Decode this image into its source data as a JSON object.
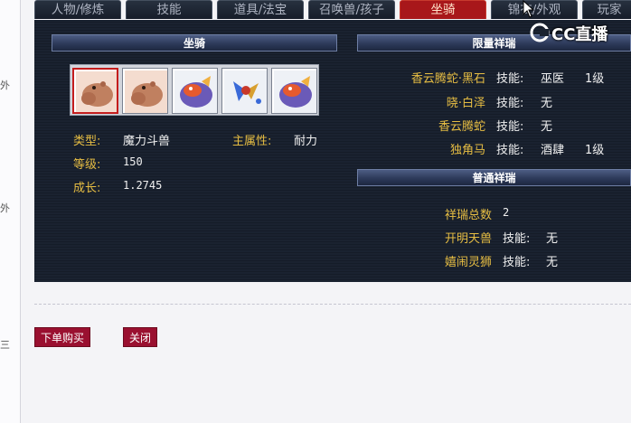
{
  "left_marks": [
    "外",
    "外",
    "三"
  ],
  "tabs": [
    "人物/修炼",
    "技能",
    "道具/法宝",
    "召唤兽/孩子",
    "坐骑",
    "锦衣/外观",
    "玩家"
  ],
  "mount_panel": {
    "header": "坐骑",
    "stats": [
      {
        "label": "类型:",
        "value": "魔力斗兽"
      },
      {
        "label": "等级:",
        "value": "150"
      },
      {
        "label": "成长:",
        "value": "1.2745"
      }
    ],
    "main_attr_label": "主属性:",
    "main_attr_value": "耐力"
  },
  "limited": {
    "header": "限量祥瑞",
    "skill_label": "技能:",
    "items": [
      {
        "name": "香云腾蛇·黑石",
        "skill": "巫医",
        "level": "1级"
      },
      {
        "name": "晓·白泽",
        "skill": "无",
        "level": ""
      },
      {
        "name": "香云腾蛇",
        "skill": "无",
        "level": ""
      },
      {
        "name": "独角马",
        "skill": "酒肆",
        "level": "1级"
      }
    ]
  },
  "normal": {
    "header": "普通祥瑞",
    "total_label": "祥瑞总数",
    "total_value": "2",
    "skill_label": "技能:",
    "items": [
      {
        "name": "开明天兽",
        "skill": "无"
      },
      {
        "name": "嬉闹灵狮",
        "skill": "无"
      }
    ]
  },
  "buttons": {
    "buy": "下单购买",
    "close": "关闭"
  },
  "watermark": "CC直播",
  "colors": {
    "accent": "#a8171a",
    "gold": "#e6bd43",
    "button": "#9a1030"
  }
}
